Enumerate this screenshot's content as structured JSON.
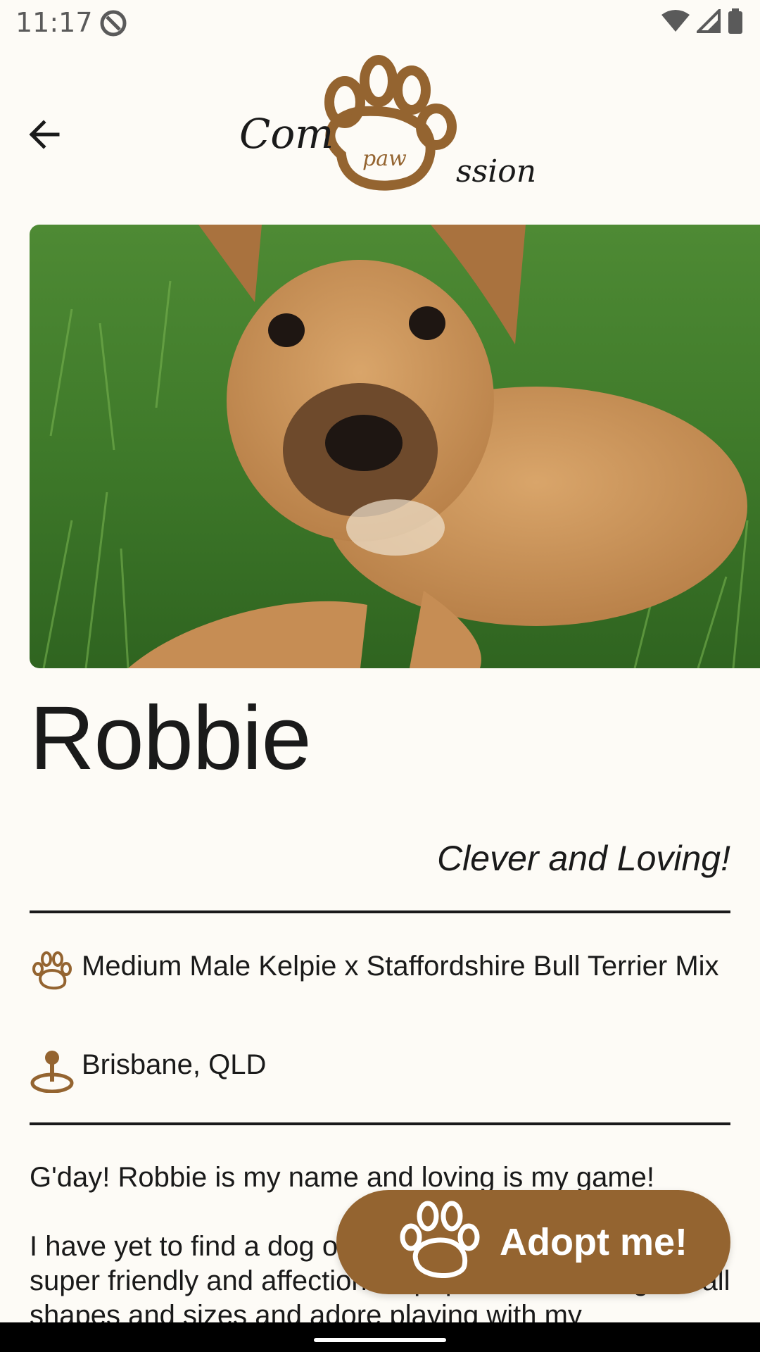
{
  "status_bar": {
    "time": "11:17"
  },
  "header": {
    "logo_text": "Compawssion",
    "logo_paw_text": "paw"
  },
  "pet": {
    "name": "Robbie",
    "tagline": "Clever and Loving!",
    "breed": "Medium Male Kelpie x Staffordshire Bull Terrier Mix",
    "location": "Brisbane, QLD",
    "description": "G'day! Robbie is my name and loving is my game!\n\nI have yet to find a dog or person I don't like. I am a super friendly and affectionate pup who loves dogs of all shapes and sizes and adore playing with my"
  },
  "actions": {
    "adopt_label": "Adopt me!"
  },
  "icons": {
    "back": "back-arrow-icon",
    "breed": "paw-icon",
    "location": "location-pin-icon",
    "adopt": "paw-icon"
  },
  "colors": {
    "background": "#fdfbf6",
    "brand_brown": "#946430",
    "text": "#1a1a1a"
  }
}
